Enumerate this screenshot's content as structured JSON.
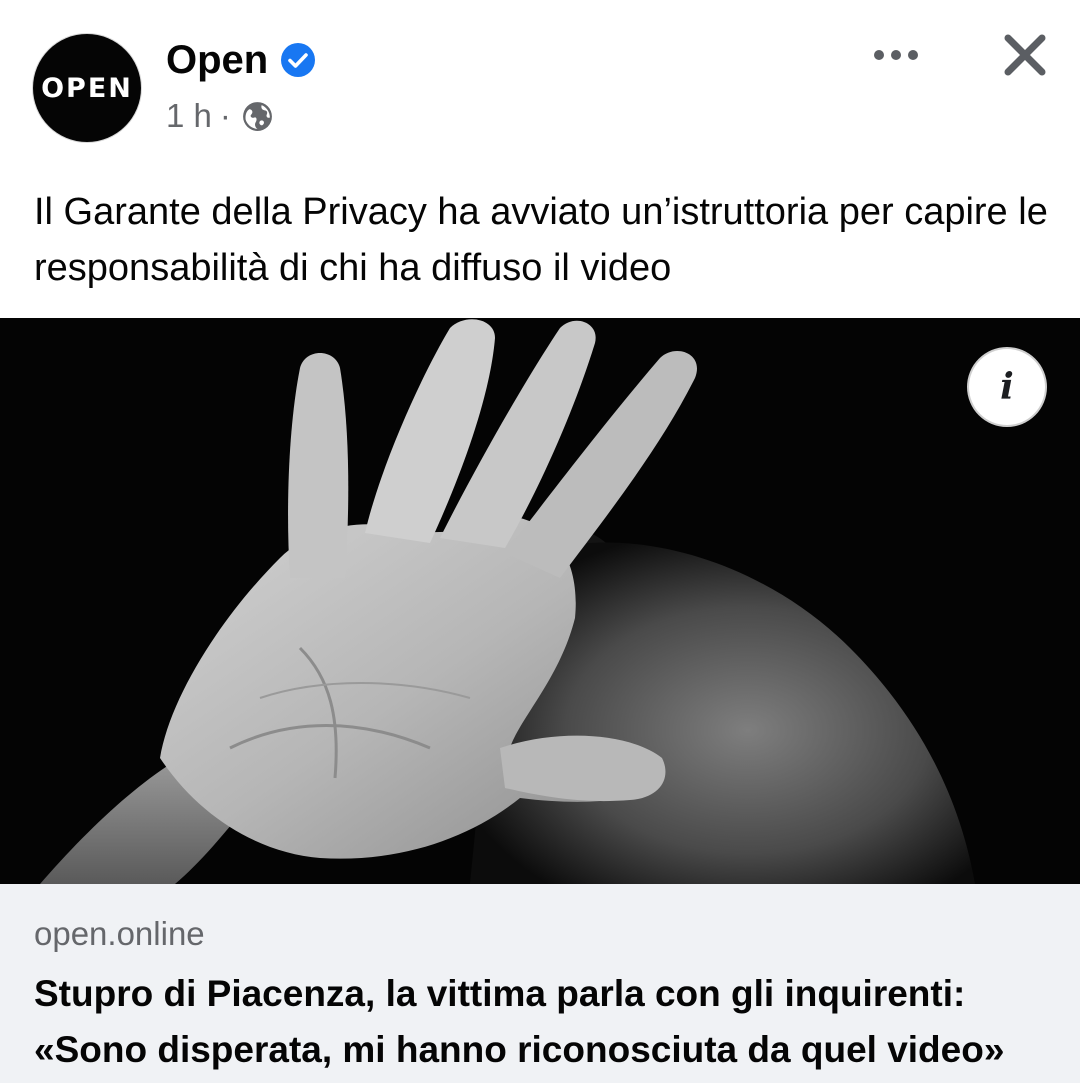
{
  "post": {
    "author": {
      "name": "Open",
      "avatar_text": "OPEN",
      "verified": true
    },
    "timestamp": "1 h",
    "separator": "·",
    "audience_icon": "globe-icon",
    "caption": "Il Garante della Privacy ha avviato un’istruttoria per capire le responsabilità di chi ha diffuso il video",
    "image": {
      "info_label": "i"
    },
    "link": {
      "domain": "open.online",
      "title_line1": "Stupro di Piacenza, la vittima parla con gli inquirenti:",
      "title_line2": "«Sono disperata, mi hanno riconosciuta da quel video»"
    }
  },
  "icons": {
    "more": "more-dots-icon",
    "close": "close-icon",
    "verified": "verified-badge-icon",
    "globe": "globe-icon",
    "info": "info-icon"
  },
  "colors": {
    "verified_blue": "#1877f2",
    "secondary_text": "#65676b",
    "link_bg": "#f0f2f5"
  }
}
